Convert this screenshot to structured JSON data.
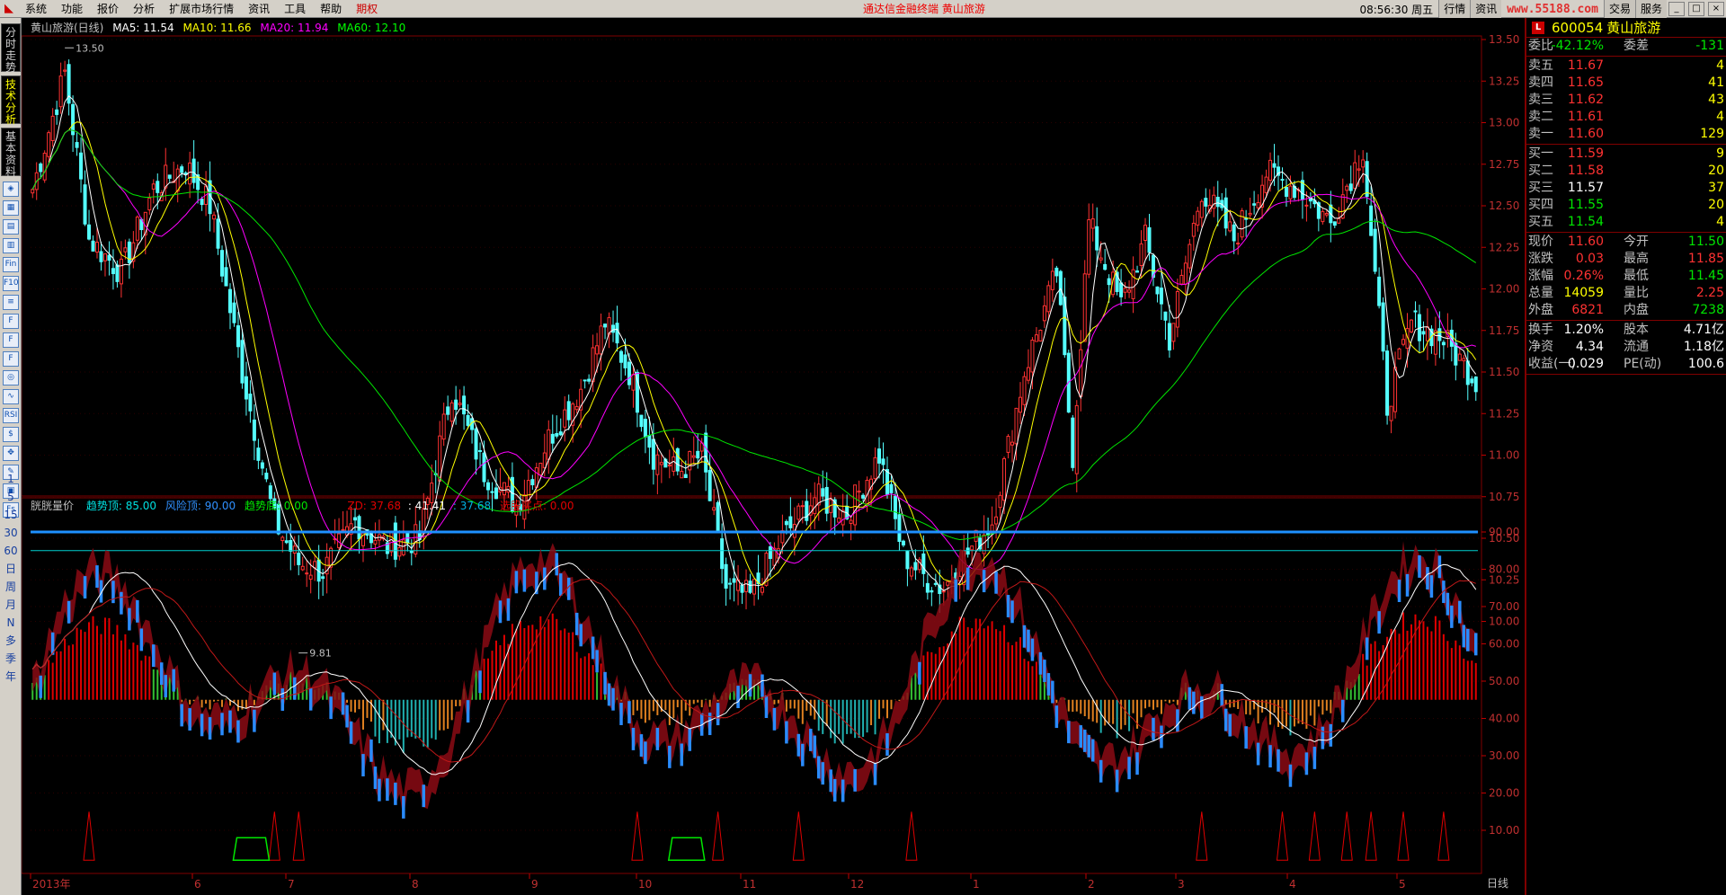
{
  "menubar": {
    "items": [
      "系统",
      "功能",
      "报价",
      "分析",
      "扩展市场行情",
      "资讯",
      "工具",
      "帮助"
    ],
    "special": "期权",
    "center": "通达信金融终端    黄山旅游",
    "time": "08:56:30 周五",
    "tabs": [
      "行情",
      "资讯",
      "交易",
      "服务"
    ],
    "watermark": "www.55188.com"
  },
  "lefttools": {
    "vtabs": [
      "分时走势",
      "技术分析",
      "基本资料"
    ],
    "tools": [
      "◈",
      "▦",
      "▤",
      "▥",
      "Fin",
      "F10",
      "≡",
      "F",
      "F",
      "F",
      "◎",
      "∿",
      "RSI",
      "$",
      "✥",
      "✎",
      "▣",
      "Fs"
    ],
    "periods": [
      "1",
      "5",
      "15",
      "30",
      "60",
      "日",
      "周",
      "月",
      "N",
      "多",
      "季",
      "年"
    ]
  },
  "main_chart": {
    "title": "黄山旅游(日线)",
    "ma5": "MA5: 11.54",
    "ma10": "MA10: 11.66",
    "ma20": "MA20: 11.94",
    "ma60": "MA60: 12.10",
    "high_label": "13.50",
    "low_label": "9.81",
    "yticks": [
      "13.50",
      "13.25",
      "13.00",
      "12.75",
      "12.50",
      "12.25",
      "12.00",
      "11.75",
      "11.50",
      "11.25",
      "11.00",
      "10.75",
      "10.50",
      "10.25",
      "10.00"
    ]
  },
  "sub_chart": {
    "name": "胱胱量价",
    "p1": "趋势顶: 85.00",
    "p2": "风险顶: 90.00",
    "p3": "趋势底: 0.00",
    "zd": "ZD: 37.68",
    "v2": ": 41.41",
    "v3": ": 37.68",
    "p4": "选股买点: 0.00",
    "yticks": [
      "90.00",
      "80.00",
      "70.00",
      "60.00",
      "50.00",
      "40.00",
      "30.00",
      "20.00",
      "10.00"
    ]
  },
  "xaxis": {
    "labels": [
      "2013年",
      "6",
      "7",
      "8",
      "9",
      "10",
      "11",
      "12",
      "1",
      "2",
      "3",
      "4",
      "5"
    ],
    "period": "日线"
  },
  "quote": {
    "code": "600054",
    "name": "黄山旅游",
    "weibi_label": "委比",
    "weibi": "-42.12%",
    "weicha_label": "委差",
    "weicha": "-131",
    "asks": [
      {
        "label": "卖五",
        "price": "11.67",
        "vol": "4"
      },
      {
        "label": "卖四",
        "price": "11.65",
        "vol": "41"
      },
      {
        "label": "卖三",
        "price": "11.62",
        "vol": "43"
      },
      {
        "label": "卖二",
        "price": "11.61",
        "vol": "4"
      },
      {
        "label": "卖一",
        "price": "11.60",
        "vol": "129"
      }
    ],
    "bids": [
      {
        "label": "买一",
        "price": "11.59",
        "vol": "9"
      },
      {
        "label": "买二",
        "price": "11.58",
        "vol": "20"
      },
      {
        "label": "买三",
        "price": "11.57",
        "vol": "37"
      },
      {
        "label": "买四",
        "price": "11.55",
        "vol": "20"
      },
      {
        "label": "买五",
        "price": "11.54",
        "vol": "4"
      }
    ],
    "stats": [
      {
        "l1": "现价",
        "v1": "11.60",
        "c1": "red",
        "l2": "今开",
        "v2": "11.50",
        "c2": "grn"
      },
      {
        "l1": "涨跌",
        "v1": "0.03",
        "c1": "red",
        "l2": "最高",
        "v2": "11.85",
        "c2": "red"
      },
      {
        "l1": "涨幅",
        "v1": "0.26%",
        "c1": "red",
        "l2": "最低",
        "v2": "11.45",
        "c2": "grn"
      },
      {
        "l1": "总量",
        "v1": "14059",
        "c1": "yel",
        "l2": "量比",
        "v2": "2.25",
        "c2": "red"
      },
      {
        "l1": "外盘",
        "v1": "6821",
        "c1": "red",
        "l2": "内盘",
        "v2": "7238",
        "c2": "grn"
      }
    ],
    "stats2": [
      {
        "l1": "换手",
        "v1": "1.20%",
        "l2": "股本",
        "v2": "4.71亿"
      },
      {
        "l1": "净资",
        "v1": "4.34",
        "l2": "流通",
        "v2": "1.18亿"
      },
      {
        "l1": "收益(一)",
        "v1": "0.029",
        "l2": "PE(动)",
        "v2": "100.6"
      }
    ]
  }
}
